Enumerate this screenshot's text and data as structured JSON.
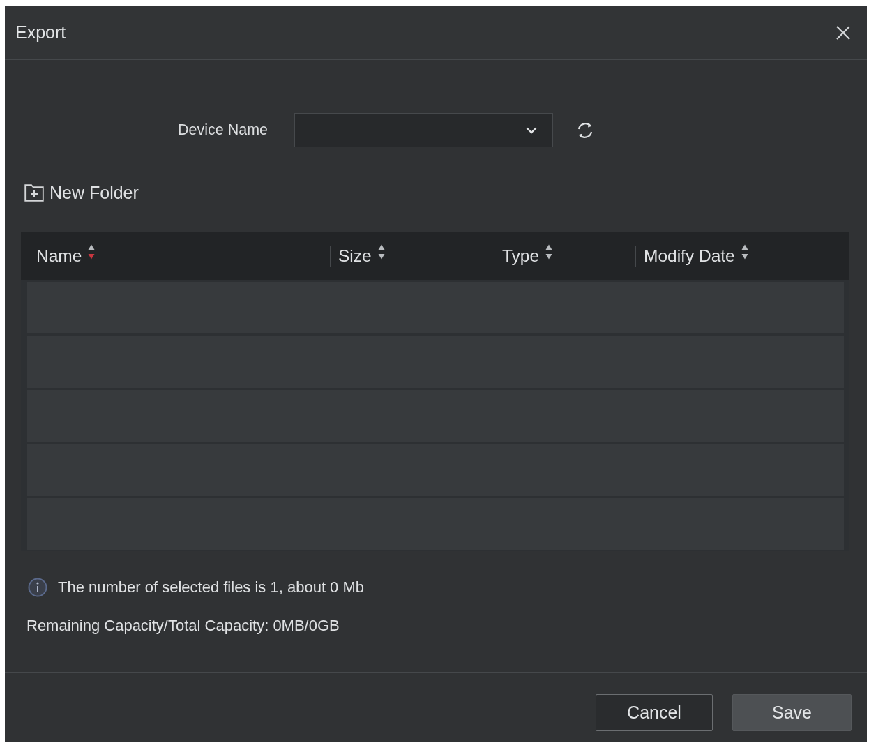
{
  "window": {
    "title": "Export"
  },
  "device": {
    "label": "Device Name"
  },
  "new_folder": {
    "label": "New Folder"
  },
  "table": {
    "columns": [
      {
        "label": "Name",
        "sorted": true
      },
      {
        "label": "Size",
        "sorted": false
      },
      {
        "label": "Type",
        "sorted": false
      },
      {
        "label": "Modify Date",
        "sorted": false
      }
    ]
  },
  "info": {
    "selection": "The number of selected files is 1, about 0 Mb",
    "capacity": "Remaining Capacity/Total Capacity: 0MB/0GB"
  },
  "buttons": [
    {
      "label": "Cancel",
      "kind": "secondary"
    },
    {
      "label": "Save",
      "kind": "primary"
    }
  ]
}
